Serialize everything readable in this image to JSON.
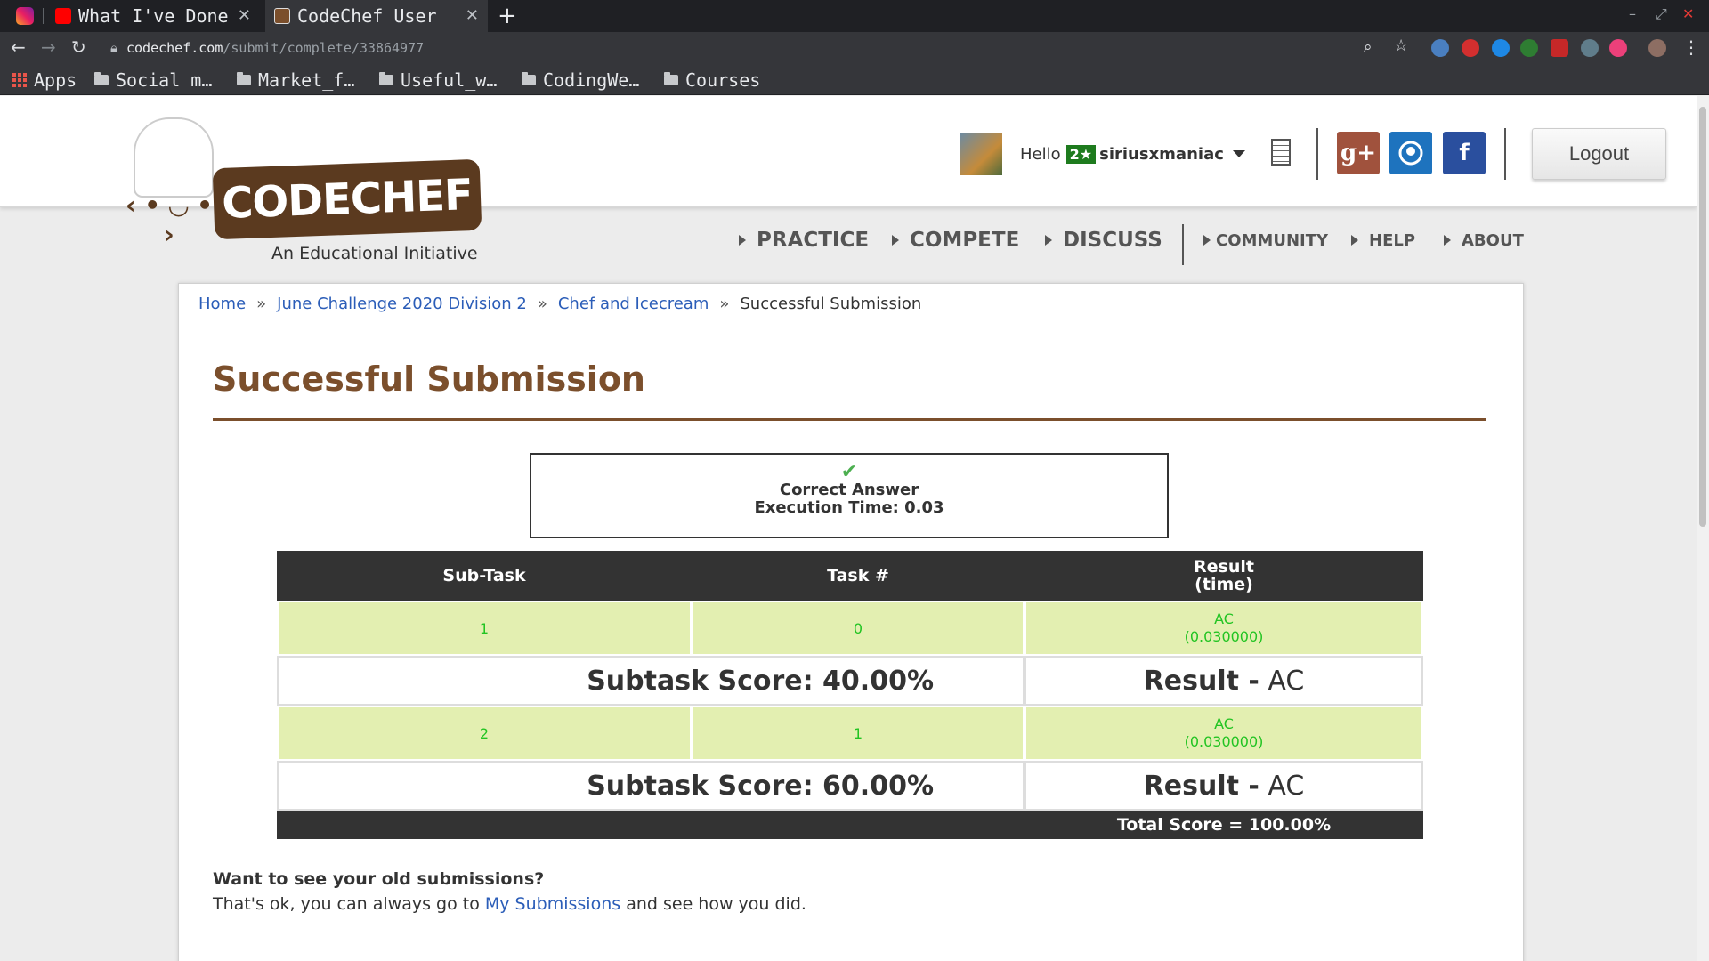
{
  "browser": {
    "tabs": [
      {
        "title": "What I've Done",
        "favicon": "youtube-icon",
        "color": "#ff0000"
      },
      {
        "title": "CodeChef User",
        "favicon": "codechef-icon",
        "color": "#7b4f2c"
      }
    ],
    "address": {
      "domain": "codechef.com",
      "path": "/submit/complete/33864977"
    },
    "bookmarks": [
      "Apps",
      "Social m…",
      "Market_f…",
      "Useful_w…",
      "CodingWe…",
      "Courses"
    ]
  },
  "header": {
    "logo_text": "CODECHEF",
    "tagline": "An Educational Initiative",
    "hello": "Hello",
    "star_rating": "2★",
    "username": "siriusxmaniac",
    "social": {
      "google": "g+",
      "facebook": "f"
    },
    "logout": "Logout"
  },
  "nav": {
    "primary": [
      "PRACTICE",
      "COMPETE",
      "DISCUSS"
    ],
    "secondary": [
      "COMMUNITY",
      "HELP",
      "ABOUT"
    ]
  },
  "breadcrumb": {
    "home": "Home",
    "contest": "June Challenge 2020 Division 2",
    "problem": "Chef and Icecream",
    "current": "Successful Submission",
    "separator": "»"
  },
  "title": "Successful Submission",
  "result_box": {
    "status": "Correct Answer",
    "exec_label": "Execution Time: 0.03"
  },
  "table": {
    "headers": {
      "subtask": "Sub-Task",
      "task": "Task #",
      "result_l1": "Result",
      "result_l2": "(time)"
    },
    "rows": [
      {
        "subtask": "1",
        "task": "0",
        "result": "AC",
        "time": "(0.030000)",
        "score_label": "Subtask Score: 40.00%",
        "result_label": "Result -",
        "result_value": "AC"
      },
      {
        "subtask": "2",
        "task": "1",
        "result": "AC",
        "time": "(0.030000)",
        "score_label": "Subtask Score: 60.00%",
        "result_label": "Result -",
        "result_value": "AC"
      }
    ],
    "total": "Total Score = 100.00%"
  },
  "footer": {
    "question": "Want to see your old submissions?",
    "before": "That's ok, you can always go to",
    "link": "My Submissions",
    "after": "and see how you did."
  },
  "colors": {
    "brand": "#7b4f2c",
    "link": "#2b5db8",
    "ac_green": "#22c422",
    "row_bg": "#e3efb1"
  }
}
